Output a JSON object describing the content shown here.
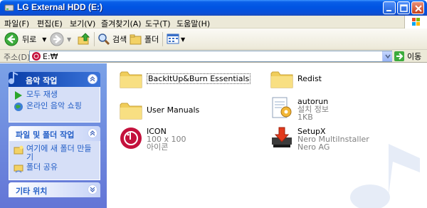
{
  "window": {
    "title": "LG External HDD (E:)"
  },
  "menu": [
    "파일(F)",
    "편집(E)",
    "보기(V)",
    "즐겨찾기(A)",
    "도구(T)",
    "도움말(H)"
  ],
  "toolbar": {
    "back_label": "뒤로",
    "search_label": "검색",
    "folders_label": "폴더"
  },
  "address": {
    "label": "주소(D)",
    "value": "E:₩",
    "go_label": "이동"
  },
  "taskpane": {
    "music": {
      "title": "음악 작업",
      "items": [
        "모두 재생",
        "온라인 음악 쇼핑"
      ]
    },
    "file_folder": {
      "title": "파일 및 폴더 작업",
      "items": [
        "여기에 새 폴더 만들기",
        "폴더 공유"
      ]
    },
    "other": {
      "title": "기타 위치"
    }
  },
  "files": [
    {
      "name": "BackItUp&Burn Essentials",
      "type": "folder"
    },
    {
      "name": "Redist",
      "type": "folder"
    },
    {
      "name": "User Manuals",
      "type": "folder"
    },
    {
      "name": "autorun",
      "sub1": "설치 정보",
      "sub2": "1KB",
      "type": "ini"
    },
    {
      "name": "ICON",
      "sub1": "100 x 100",
      "sub2": "아이콘",
      "type": "icon"
    },
    {
      "name": "SetupX",
      "sub1": "Nero MultiInstaller",
      "sub2": "Nero AG",
      "type": "setup"
    }
  ]
}
